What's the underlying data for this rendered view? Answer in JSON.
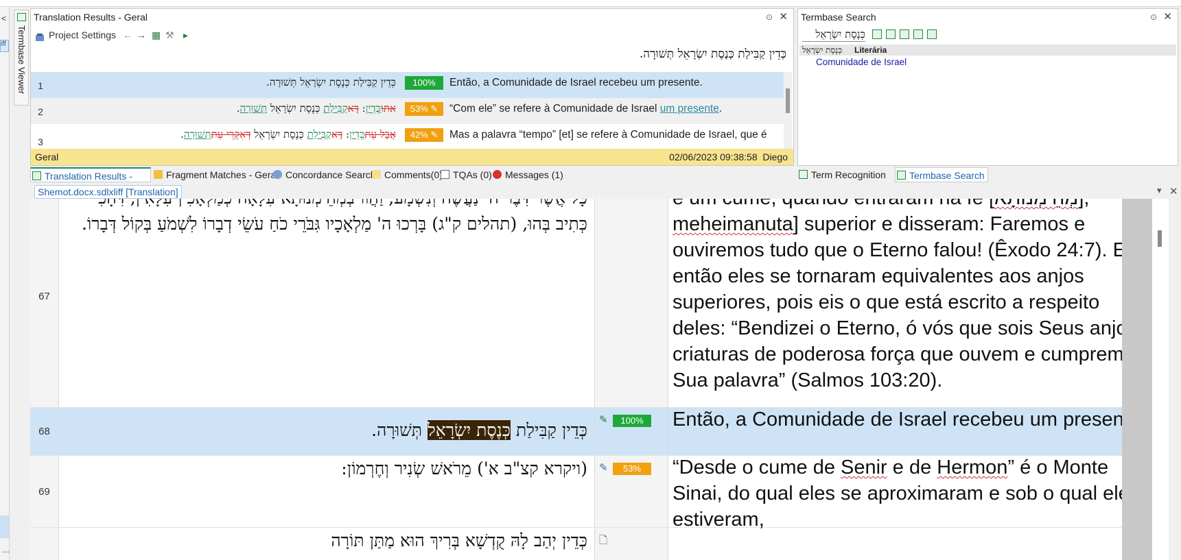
{
  "left_dock": {
    "arrow": "<",
    "tag": "iff",
    "more": "…"
  },
  "termbase_viewer_tab": {
    "label": "Termbase Viewer"
  },
  "translation_results": {
    "title": "Translation Results - Geral",
    "pin": "📌",
    "close": "✕",
    "toolbar": {
      "project_settings": "Project Settings"
    },
    "source_line": "כְּדֵין קַבִּילַת כְּנֶסֶת יִשְׂרָאֵל תְּשׁוּרָה.",
    "rows": [
      {
        "num": "1",
        "src": "כְּדֵין קַבִּילַת כְּנֶסֶת יִשְׂרָאֵל תְּשׁוּרָה.",
        "pct": "100%",
        "tgt": "Então, a Comunidade de Israel recebeu um presente."
      },
      {
        "num": "2",
        "src_parts": [
          "אתו",
          "כְּדֵין",
          ": ",
          "דָּא",
          "קַבִּילַת",
          " כְּנֶסֶת יִשְׂרָאֵל ",
          "תְּשׁוּרָה",
          "."
        ],
        "pct": "53%",
        "tgt_plain": "“Com ele” se refere à Comunidade de Israel ",
        "tgt_link": "um presente",
        "tgt_end": "."
      },
      {
        "num": "3",
        "src_parts": [
          "אֲבָל עֵת",
          "כְּדֵין",
          ": ",
          "דָּא",
          "קַבִּילַת",
          " כְּנֶסֶת יִשְׂרָאֵל ",
          "דְּאִקְרֵי עֵת",
          "תְּשׁוּרָה",
          "."
        ],
        "pct": "42%",
        "tgt": "Mas a palavra “tempo” [et] se refere à Comunidade de Israel, que é"
      }
    ],
    "status_left": "Geral",
    "status_date": "02/06/2023 09:38:58",
    "status_user": "Diego"
  },
  "termbase_search": {
    "title": "Termbase Search",
    "query": "כְּנֶסֶת יִשְׂרָאֵל",
    "header_term": "כְּנֶסֶת יִשְׂרָאֵל",
    "header_field": "Literária",
    "result": "Comunidade de Israel"
  },
  "tabs_left": [
    {
      "label": "Translation Results - Geral"
    },
    {
      "label": "Fragment Matches - Geral"
    },
    {
      "label": "Concordance Search"
    },
    {
      "label": "Comments(0)"
    },
    {
      "label": "TQAs (0)"
    },
    {
      "label": "Messages (1)"
    }
  ],
  "tabs_right": [
    {
      "label": "Term Recognition"
    },
    {
      "label": "Termbase Search"
    }
  ],
  "doc_tab": {
    "label": "Shemot.docx.sdlxliff [Translation]"
  },
  "editor": {
    "row67": {
      "num": "67",
      "src": "כָּל אֲשֶׁר דִּבֶּר ה' נַעֲשֶׂה וְנִשְׁמָע, וַהֲווֹ בְּמְהֵימְנוּתָא עִלָּאָה כְּמַלְאָכִין עִלָּאִין, דִּהָכִי כְּתִיב בְּהוּ, (תהלים ק\"ג) בָּרְכוּ ה' מַלְאָכָיו גִּבֹּרֵי כֹחַ עֹשֵׂי דְבָרוֹ לִשְׁמֹעַ בְּקוֹל דְּבָרוֹ.",
      "tgt_top": "e um cume, quando entraram na fé [",
      "tgt_heb": "מְהֵימְנוּתָא",
      "tgt_top_end": "],",
      "tgt_spell": "meheimanuta",
      "tgt_rest": "] superior e disseram: Faremos e ouviremos tudo que o Eterno falou! (Êxodo 24:7). E então eles se tornaram equivalentes aos anjos superiores, pois eis o que está escrito a respeito deles: “Bendizei o Eterno, ó vós que sois Seus anjos, criaturas de poderosa força que ouvem e cumprem Sua palavra” (Salmos 103:20)."
    },
    "row68": {
      "num": "68",
      "src_a": "כְּדֵין קַבִּילַת ",
      "src_hl": "כְּנֶסֶת יִשְׂרָאֵל",
      "src_b": " תְּשׁוּרָה.",
      "badge": "100%",
      "tgt": "Então, a Comunidade de Israel recebeu um presente."
    },
    "row69": {
      "num": "69",
      "src": "(ויקרא קצ\"ב א') מֵרֹאשׁ שְׂנִיר וְחֶרְמוֹן:",
      "badge": "53%",
      "tgt_a": "“Desde o cume de ",
      "tgt_s1": "Senir",
      "tgt_b": " e de ",
      "tgt_s2": "Hermon",
      "tgt_c": "” é o Monte Sinai, do qual eles se aproximaram e sob o qual eles estiveram,"
    },
    "row70": {
      "src": "כְּדֵין יְהַב לָהּ קֻדְשָׁא בְּרִיךְ הוּא מַתַּן תּוֹרָה"
    }
  },
  "colors": {
    "match_100": "#1fa83a",
    "match_fuzzy": "#f0a010",
    "active_row": "#cfe3f6",
    "status_bar": "#f8e48e",
    "highlight": "#3b2507"
  }
}
